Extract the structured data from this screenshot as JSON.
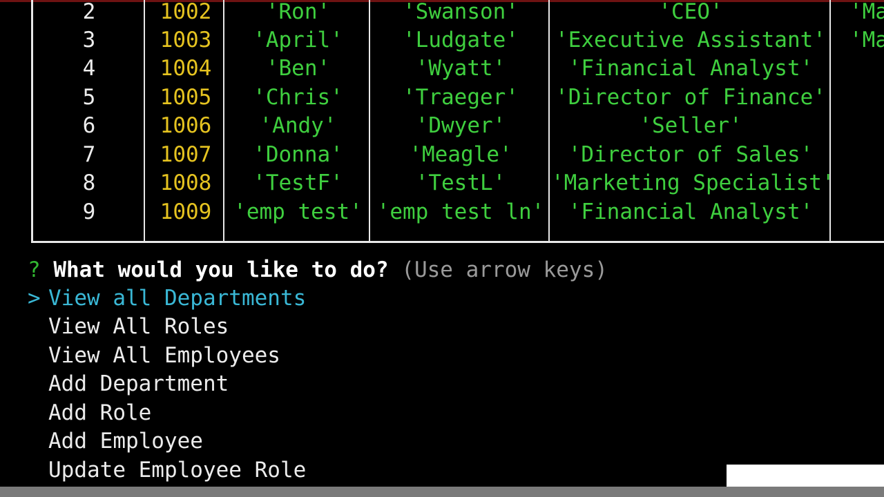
{
  "table": {
    "rows": [
      {
        "index": "2",
        "id": "1002",
        "first_name": "'Ron'",
        "last_name": "'Swanson'",
        "title": "'CEO'",
        "manager": "'Ma"
      },
      {
        "index": "3",
        "id": "1003",
        "first_name": "'April'",
        "last_name": "'Ludgate'",
        "title": "'Executive Assistant'",
        "manager": "'Ma"
      },
      {
        "index": "4",
        "id": "1004",
        "first_name": "'Ben'",
        "last_name": "'Wyatt'",
        "title": "'Financial Analyst'",
        "manager": ""
      },
      {
        "index": "5",
        "id": "1005",
        "first_name": "'Chris'",
        "last_name": "'Traeger'",
        "title": "'Director of Finance'",
        "manager": ""
      },
      {
        "index": "6",
        "id": "1006",
        "first_name": "'Andy'",
        "last_name": "'Dwyer'",
        "title": "'Seller'",
        "manager": ""
      },
      {
        "index": "7",
        "id": "1007",
        "first_name": "'Donna'",
        "last_name": "'Meagle'",
        "title": "'Director of Sales'",
        "manager": ""
      },
      {
        "index": "8",
        "id": "1008",
        "first_name": "'TestF'",
        "last_name": "'TestL'",
        "title": "'Marketing Specialist'",
        "manager": ""
      },
      {
        "index": "9",
        "id": "1009",
        "first_name": "'emp test'",
        "last_name": "'emp test ln'",
        "title": "'Financial Analyst'",
        "manager": ""
      }
    ]
  },
  "prompt": {
    "mark": "?",
    "question": "What would you like to do?",
    "hint": "(Use arrow keys)"
  },
  "menu": {
    "pointer": ">",
    "selected_index": 0,
    "choices": [
      "View all Departments",
      "View All Roles",
      "View All Employees",
      "Add Department",
      "Add Role",
      "Add Employee",
      "Update Employee Role"
    ]
  },
  "colors": {
    "background": "#000000",
    "string_green": "#3fcf3f",
    "number_yellow": "#e5c320",
    "selected_cyan": "#3ab8d6",
    "hint_gray": "#9a9a9a"
  }
}
